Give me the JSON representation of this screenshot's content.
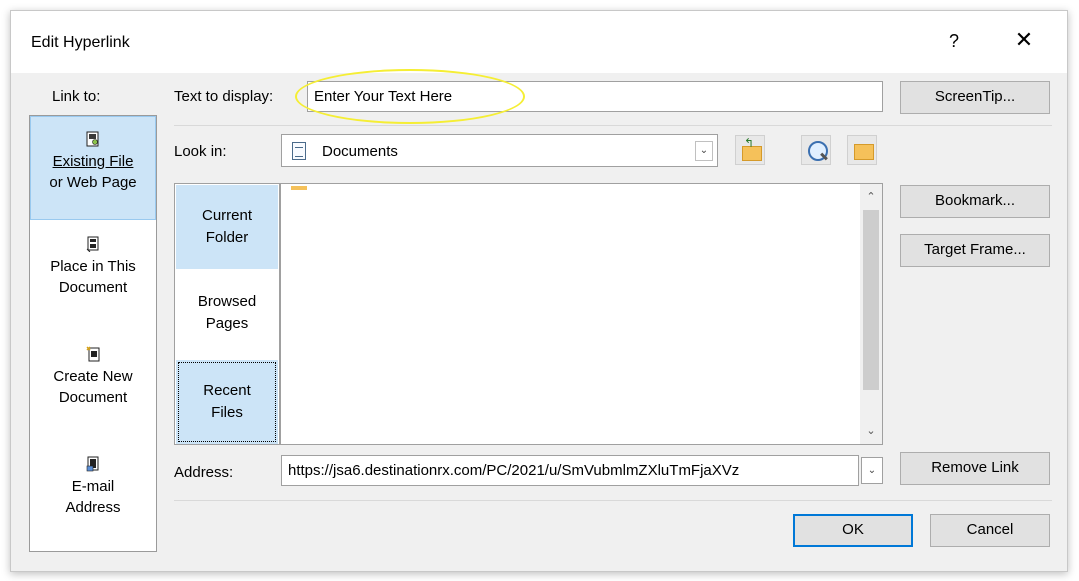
{
  "window": {
    "title": "Edit Hyperlink",
    "help": "?",
    "close": "✕"
  },
  "link_to": {
    "label": "Link to:",
    "items": [
      {
        "line1": "Existing File",
        "line2": "or Web Page",
        "icon": "existing-file-icon",
        "selected": true
      },
      {
        "line1": "Place in This",
        "line2": "Document",
        "icon": "place-in-document-icon",
        "selected": false
      },
      {
        "line1": "Create New",
        "line2": "Document",
        "icon": "create-new-document-icon",
        "selected": false
      },
      {
        "line1": "E-mail",
        "line2": "Address",
        "icon": "email-address-icon",
        "selected": false
      }
    ]
  },
  "text_to_display": {
    "label": "Text to display:",
    "value": "Enter Your Text Here"
  },
  "look_in": {
    "label": "Look in:",
    "value": "Documents"
  },
  "nav": {
    "items": [
      {
        "line1": "Current",
        "line2": "Folder"
      },
      {
        "line1": "Browsed",
        "line2": "Pages"
      },
      {
        "line1": "Recent",
        "line2": "Files"
      }
    ]
  },
  "address": {
    "label": "Address:",
    "value": "https://jsa6.destinationrx.com/PC/2021/u/SmVubmlmZXluTmFjaXVz"
  },
  "buttons": {
    "screentip": "ScreenTip...",
    "bookmark": "Bookmark...",
    "target_frame": "Target Frame...",
    "remove_link": "Remove Link",
    "ok": "OK",
    "cancel": "Cancel"
  },
  "colors": {
    "selected_bg": "#cce4f7",
    "accent": "#0078d7",
    "highlight_ellipse": "#f5ee34"
  }
}
